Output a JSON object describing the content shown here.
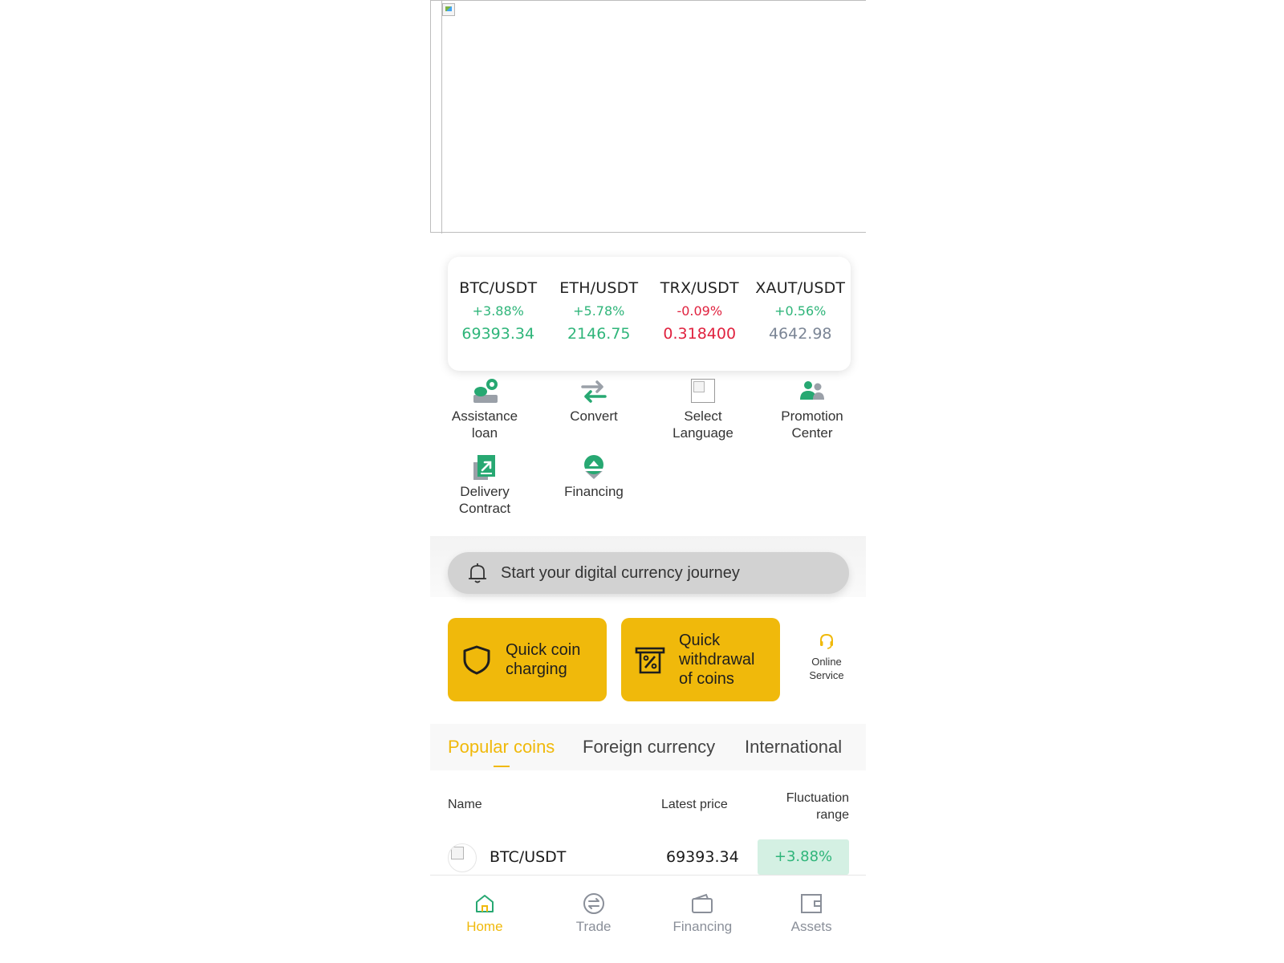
{
  "ticker": [
    {
      "pair": "BTC/USDT",
      "change": "+3.88%",
      "price": "69393.34",
      "tone": "green"
    },
    {
      "pair": "ETH/USDT",
      "change": "+5.78%",
      "price": "2146.75",
      "tone": "green"
    },
    {
      "pair": "TRX/USDT",
      "change": "-0.09%",
      "price": "0.318400",
      "tone": "red"
    },
    {
      "pair": "XAUT/USDT",
      "change": "+0.56%",
      "price": "4642.98",
      "tone": "gray"
    }
  ],
  "features": [
    {
      "label": "Assistance\nloan",
      "icon": "loan-icon"
    },
    {
      "label": "Convert",
      "icon": "convert-icon"
    },
    {
      "label": "Select\nLanguage",
      "icon": "language-image"
    },
    {
      "label": "Promotion\nCenter",
      "icon": "users-icon"
    },
    {
      "label": "Delivery\nContract",
      "icon": "contract-icon"
    },
    {
      "label": "Financing",
      "icon": "financing-icon"
    }
  ],
  "notice": {
    "text": "Start your digital currency journey"
  },
  "quick": {
    "charge_label": "Quick coin\ncharging",
    "withdraw_label": "Quick\nwithdrawal\nof coins",
    "online_label": "Online\nService"
  },
  "tabs": [
    {
      "label": "Popular coins",
      "active": true
    },
    {
      "label": "Foreign currency",
      "active": false
    },
    {
      "label": "International",
      "active": false
    }
  ],
  "table": {
    "headers": {
      "name": "Name",
      "price": "Latest price",
      "fluctuation": "Fluctuation\nrange"
    },
    "rows": [
      {
        "name": "BTC/USDT",
        "price": "69393.34",
        "change": "+3.88%"
      }
    ]
  },
  "nav": [
    {
      "label": "Home",
      "icon": "home-icon",
      "active": true
    },
    {
      "label": "Trade",
      "icon": "trade-icon",
      "active": false
    },
    {
      "label": "Financing",
      "icon": "wallet-icon",
      "active": false
    },
    {
      "label": "Assets",
      "icon": "assets-icon",
      "active": false
    }
  ],
  "colors": {
    "accent": "#f0b90b",
    "up": "#2fb57a",
    "down": "#e0223f",
    "icon_green": "#27a872"
  }
}
